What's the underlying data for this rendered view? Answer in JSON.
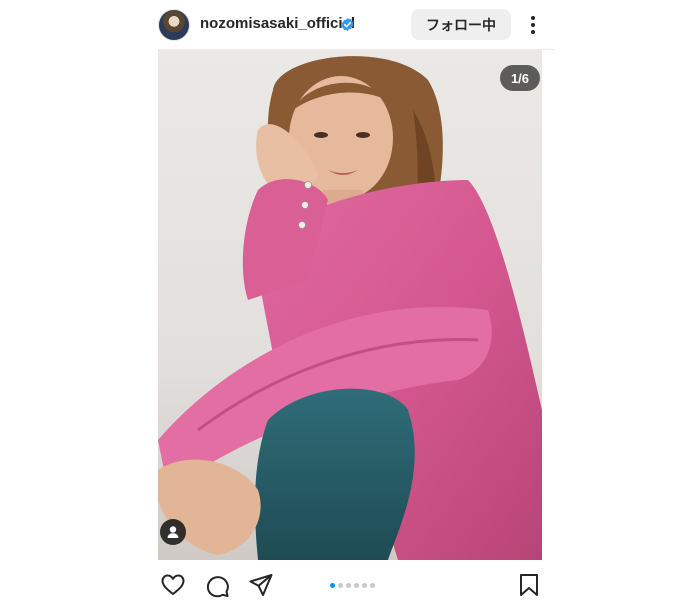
{
  "header": {
    "username": "nozomisasaki_official",
    "follow_label": "フォロー中",
    "verified": true
  },
  "media": {
    "counter": "1/6",
    "current_slide": 1,
    "total_slides": 6
  },
  "actions": {
    "icons": [
      "heart-icon",
      "comment-icon",
      "share-icon",
      "bookmark-icon"
    ]
  },
  "colors": {
    "verified_blue": "#3897f0",
    "active_dot": "#0095f6",
    "inactive_dot": "#c7c7c7",
    "follow_button_bg": "#efefef"
  }
}
